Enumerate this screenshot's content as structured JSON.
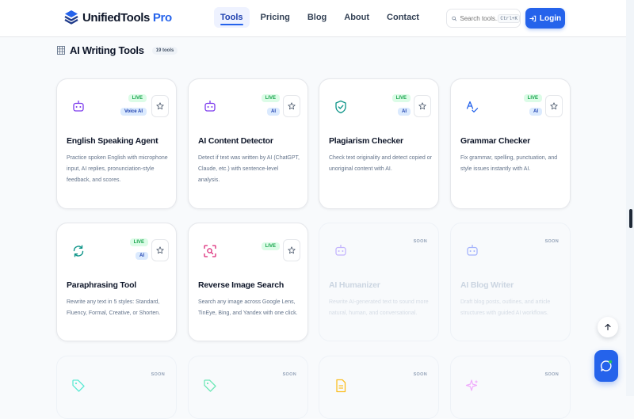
{
  "brand": {
    "name": "UnifiedTools",
    "accent": "Pro",
    "color": "#2563eb"
  },
  "nav": [
    {
      "label": "Tools",
      "active": true
    },
    {
      "label": "Pricing"
    },
    {
      "label": "Blog"
    },
    {
      "label": "About"
    },
    {
      "label": "Contact"
    }
  ],
  "search": {
    "placeholder": "Search tools...",
    "shortcut": "Ctrl+K",
    "icon": "search-icon"
  },
  "login": {
    "label": "Login",
    "icon": "login-icon"
  },
  "section": {
    "title": "AI Writing Tools",
    "count": "19 tools",
    "icon": "grid-icon"
  },
  "cards": [
    {
      "title": "English Speaking Agent",
      "desc": "Practice spoken English with microphone input, AI replies, pronunciation-style feedback, and scores.",
      "status": "LIVE",
      "category": "Voice AI",
      "icon": "robot-icon"
    },
    {
      "title": "AI Content Detector",
      "desc": "Detect if text was written by AI (ChatGPT, Claude, etc.) with sentence-level analysis.",
      "status": "LIVE",
      "category": "AI",
      "icon": "robot-icon"
    },
    {
      "title": "Plagiarism Checker",
      "desc": "Check text originality and detect copied or unoriginal content with AI.",
      "status": "LIVE",
      "category": "AI",
      "icon": "shield-check-icon"
    },
    {
      "title": "Grammar Checker",
      "desc": "Fix grammar, spelling, punctuation, and style issues instantly with AI.",
      "status": "LIVE",
      "category": "AI",
      "icon": "spell-check-icon"
    },
    {
      "title": "Paraphrasing Tool",
      "desc": "Rewrite any text in 5 styles: Standard, Fluency, Formal, Creative, or Shorten.",
      "status": "LIVE",
      "category": "AI",
      "icon": "refresh-icon"
    },
    {
      "title": "Reverse Image Search",
      "desc": "Search any image across Google Lens, TinEye, Bing, and Yandex with one click.",
      "status": "LIVE",
      "icon": "scan-search-icon"
    },
    {
      "title": "AI Humanizer",
      "desc": "Rewrite AI-generated text to sound more natural, human, and conversational.",
      "status": "SOON",
      "icon": "robot-icon"
    },
    {
      "title": "AI Blog Writer",
      "desc": "Draft blog posts, outlines, and article structures with guided AI workflows.",
      "status": "SOON",
      "icon": "robot-icon"
    },
    {
      "status": "SOON",
      "icon": "tag-icon"
    },
    {
      "status": "SOON",
      "icon": "tag-icon"
    },
    {
      "status": "SOON",
      "icon": "document-icon"
    },
    {
      "status": "SOON",
      "icon": "sparkles-icon"
    }
  ],
  "colors": {
    "live_green": "#16a34a",
    "primary": "#2563eb",
    "purple_icon": "#7c3aed",
    "teal_icon": "#0d9488",
    "pink_icon": "#db2777",
    "amber_icon": "#d97706"
  }
}
